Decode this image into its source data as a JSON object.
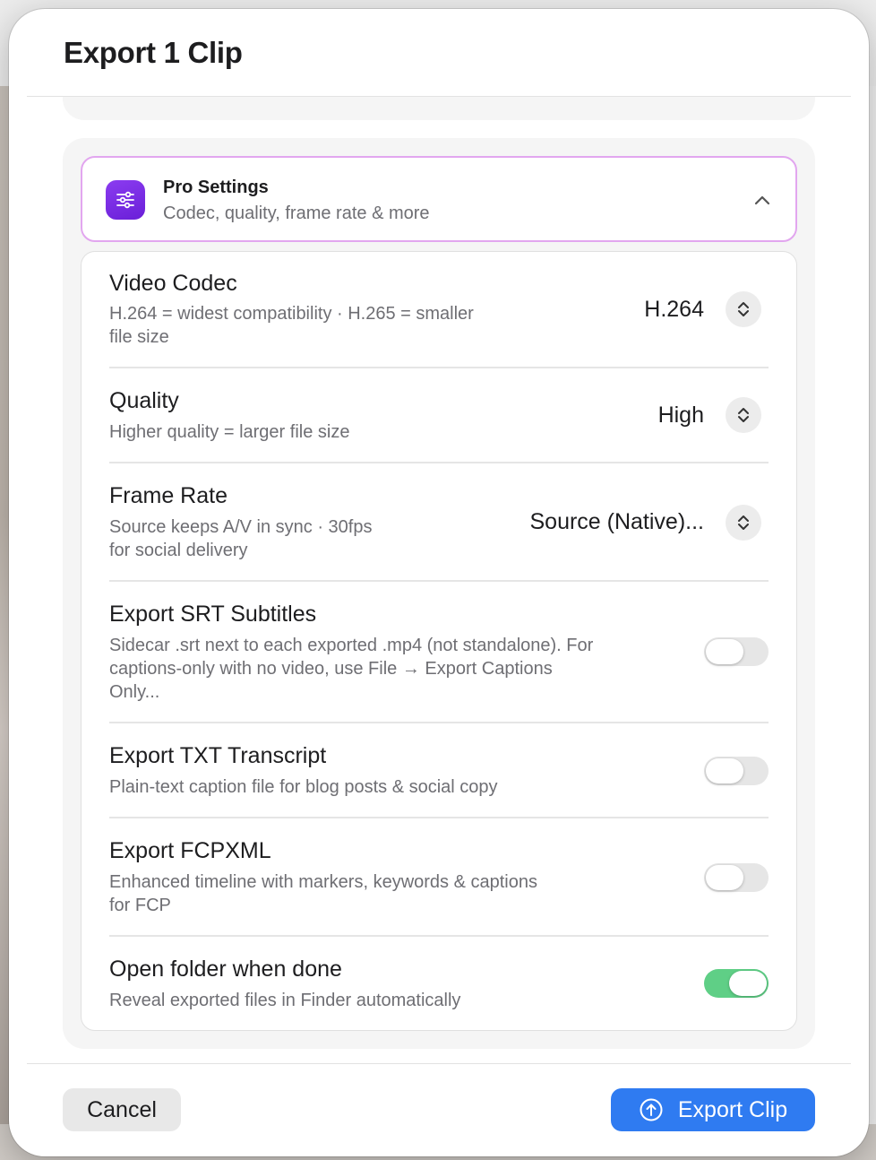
{
  "dialog": {
    "title": "Export 1 Clip"
  },
  "pro_settings": {
    "title": "Pro Settings",
    "subtitle": "Codec, quality, frame rate & more",
    "icon": "sliders-icon",
    "expanded": true
  },
  "settings": {
    "video_codec": {
      "title": "Video Codec",
      "description_line1": "H.264 = widest compatibility · H.265 = smaller",
      "description_line2": "file size",
      "value": "H.264"
    },
    "quality": {
      "title": "Quality",
      "description_line1": "Higher quality = larger file size",
      "value": "High"
    },
    "frame_rate": {
      "title": "Frame Rate",
      "description_line1": "Source keeps A/V in sync · 30fps",
      "description_line2": "for social delivery",
      "value": "Source (Native)..."
    },
    "export_srt": {
      "title": "Export SRT Subtitles",
      "description_line1": "Sidecar .srt next to each exported .mp4 (not standalone). For",
      "description_line2": "captions-only with no video, use File → Export Captions",
      "description_line3": "Only...",
      "enabled": false
    },
    "export_txt": {
      "title": "Export TXT Transcript",
      "description_line1": "Plain-text caption file for blog posts & social copy",
      "enabled": false
    },
    "export_fcpxml": {
      "title": "Export FCPXML",
      "description_line1": "Enhanced timeline with markers, keywords & captions",
      "description_line2": "for FCP",
      "enabled": false
    },
    "open_folder": {
      "title": "Open folder when done",
      "description_line1": "Reveal exported files in Finder automatically",
      "enabled": true
    }
  },
  "footer": {
    "cancel_label": "Cancel",
    "export_label": "Export Clip"
  },
  "colors": {
    "accent_blue": "#2f7bf1",
    "toggle_on_green": "#5fcf86",
    "pro_border": "#e2a6ef",
    "pro_icon_purple": "#7a2ee6"
  }
}
